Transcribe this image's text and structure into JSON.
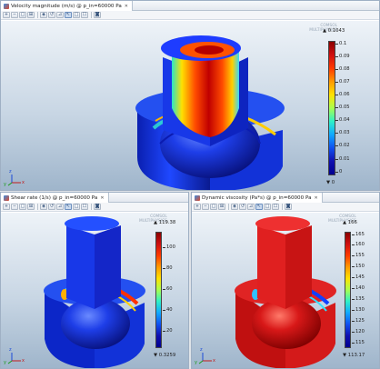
{
  "panels": {
    "top": {
      "tab_title": "Velocity magnitude (m/s) @ p_in=60000 Pa",
      "range_max": "▲ 0.1043",
      "range_min": "▼ 0",
      "ticks": [
        "0.1",
        "0.09",
        "0.08",
        "0.07",
        "0.06",
        "0.05",
        "0.04",
        "0.03",
        "0.02",
        "0.01",
        "0"
      ],
      "logo": [
        "COMSOL",
        "MULTIPHYSICS"
      ],
      "toolbar_active_index": 7
    },
    "bottom_left": {
      "tab_title": "Shear rate (1/s) @ p_in=60000 Pa",
      "range_max": "▲ 119.38",
      "range_min": "▼ 0.3259",
      "ticks": [
        "100",
        "80",
        "60",
        "40",
        "20"
      ],
      "logo": [
        "COMSOL",
        "MULTIPHYSICS"
      ],
      "toolbar_active_index": 7
    },
    "bottom_right": {
      "tab_title": "Dynamic viscosity (Pa*s) @ p_in=60000 Pa",
      "range_max": "▲ 166",
      "range_min": "▼ 113.17",
      "ticks": [
        "165",
        "160",
        "155",
        "150",
        "145",
        "140",
        "135",
        "130",
        "125",
        "120",
        "115"
      ],
      "logo": [
        "COMSOL",
        "MULTIPHYSICS"
      ],
      "toolbar_active_index": 7
    }
  },
  "axes_labels": {
    "x": "x",
    "y": "y",
    "z": "z"
  },
  "colormap": [
    "#8b0000",
    "#d01010",
    "#ff3a00",
    "#ff9a00",
    "#ffe200",
    "#a8ff50",
    "#2ef0c8",
    "#10a8ff",
    "#1050f0",
    "#1010b0",
    "#000090"
  ]
}
